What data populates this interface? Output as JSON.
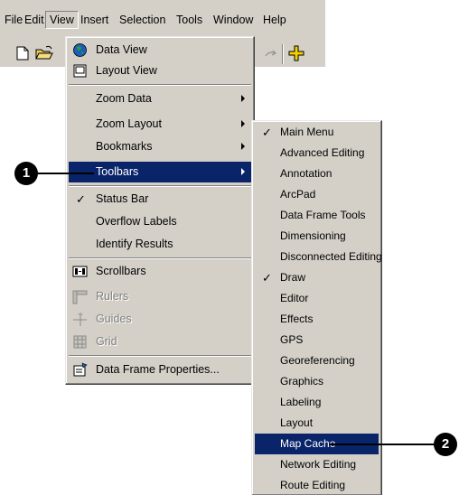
{
  "menubar": {
    "file": "File",
    "edit": "Edit",
    "view": "View",
    "insert": "Insert",
    "selection": "Selection",
    "tools": "Tools",
    "window": "Window",
    "help": "Help"
  },
  "toolbar": {
    "icons": [
      "new-document-icon",
      "open-folder-icon",
      "redo-icon",
      "add-data-icon"
    ]
  },
  "view_menu": {
    "items": [
      {
        "label": "Data View",
        "icon": "globe-icon"
      },
      {
        "label": "Layout View",
        "icon": "page-icon"
      },
      {
        "label": "Zoom Data",
        "submenu": true
      },
      {
        "label": "Zoom Layout",
        "submenu": true
      },
      {
        "label": "Bookmarks",
        "submenu": true
      },
      {
        "label": "Toolbars",
        "submenu": true,
        "highlighted": true
      },
      {
        "label": "Status Bar",
        "checked": true
      },
      {
        "label": "Overflow Labels"
      },
      {
        "label": "Identify Results"
      },
      {
        "label": "Scrollbars",
        "icon": "scrollbars-icon"
      },
      {
        "label": "Rulers",
        "icon": "rulers-icon",
        "disabled": true
      },
      {
        "label": "Guides",
        "icon": "guides-icon",
        "disabled": true
      },
      {
        "label": "Grid",
        "icon": "grid-icon",
        "disabled": true
      },
      {
        "label": "Data Frame Properties...",
        "icon": "properties-icon"
      }
    ]
  },
  "toolbars_menu": {
    "items": [
      {
        "label": "Main Menu",
        "checked": true
      },
      {
        "label": "Advanced Editing"
      },
      {
        "label": "Annotation"
      },
      {
        "label": "ArcPad"
      },
      {
        "label": "Data Frame Tools"
      },
      {
        "label": "Dimensioning"
      },
      {
        "label": "Disconnected Editing"
      },
      {
        "label": "Draw",
        "checked": true
      },
      {
        "label": "Editor"
      },
      {
        "label": "Effects"
      },
      {
        "label": "GPS"
      },
      {
        "label": "Georeferencing"
      },
      {
        "label": "Graphics"
      },
      {
        "label": "Labeling"
      },
      {
        "label": "Layout"
      },
      {
        "label": "Map Cache",
        "highlighted": true
      },
      {
        "label": "Network Editing"
      },
      {
        "label": "Route Editing"
      }
    ]
  },
  "callouts": {
    "step1": "1",
    "step2": "2"
  },
  "colors": {
    "menu_face": "#d4d0c8",
    "highlight": "#0a246a",
    "callout": "#000000"
  }
}
